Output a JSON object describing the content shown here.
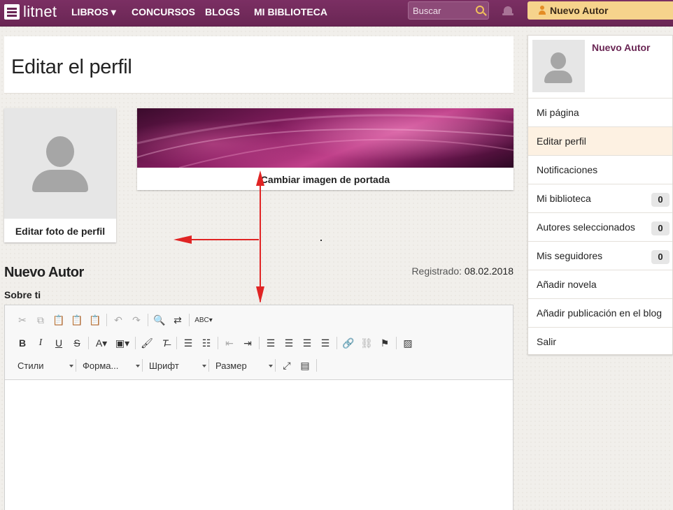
{
  "header": {
    "logo_text": "litnet",
    "nav": [
      {
        "label": "LIBROS ▾"
      },
      {
        "label": "CONCURSOS"
      },
      {
        "label": "BLOGS"
      },
      {
        "label": "MI BIBLIOTECA"
      }
    ],
    "search_placeholder": "Buscar",
    "user_button": "Nuevo Autor"
  },
  "page": {
    "title": "Editar el perfil",
    "edit_photo_label": "Editar foto de perfil",
    "cover_label": "Cambiar imagen de portada",
    "author_name": "Nuevo Autor",
    "registered_label": "Registrado:",
    "registered_date": "08.02.2018",
    "about_label": "Sobre ti"
  },
  "editor": {
    "styles_combo": "Стили",
    "format_combo": "Форма...",
    "font_combo": "Шрифт",
    "size_combo": "Размер"
  },
  "sidebar": {
    "name": "Nuevo Autor",
    "items": [
      {
        "label": "Mi página"
      },
      {
        "label": "Editar perfil"
      },
      {
        "label": "Notificaciones"
      },
      {
        "label": "Mi biblioteca",
        "badge": "0"
      },
      {
        "label": "Autores seleccionados",
        "badge": "0"
      },
      {
        "label": "Mis seguidores",
        "badge": "0"
      },
      {
        "label": "Añadir novela"
      },
      {
        "label": "Añadir publicación en el blog"
      },
      {
        "label": "Salir"
      }
    ]
  },
  "colors": {
    "brand": "#6d2858",
    "accent": "#f6d38c",
    "arrow": "#e02424"
  }
}
